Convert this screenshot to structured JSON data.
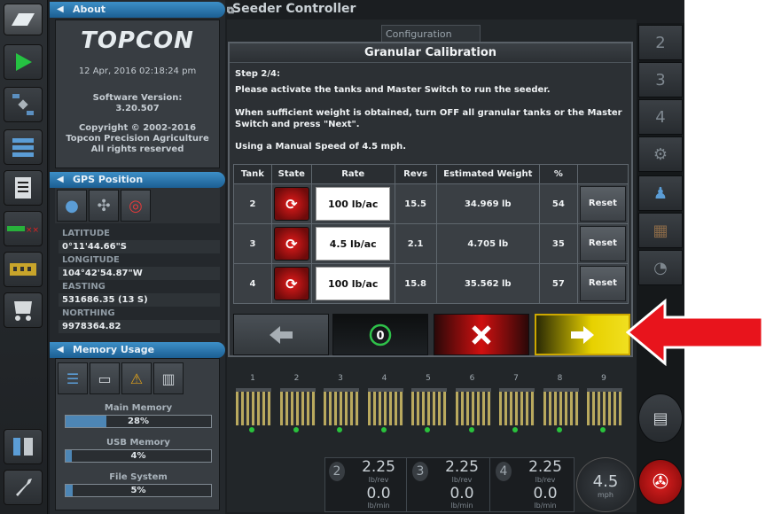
{
  "app": {
    "title": "Seeder Controller",
    "tab_behind": "Configuration"
  },
  "about": {
    "header": "About",
    "logo": "TOPCON",
    "datetime": "12 Apr, 2016  02:18:24 pm",
    "version_label": "Software Version:",
    "version": "3.20.507",
    "copyright": [
      "Copyright © 2002-2016",
      "Topcon Precision Agriculture",
      "All rights reserved"
    ]
  },
  "gps": {
    "header": "GPS Position",
    "rows": [
      {
        "label": "LATITUDE",
        "value": "0°11'44.66\"S"
      },
      {
        "label": "LONGITUDE",
        "value": "104°42'54.87\"W"
      },
      {
        "label": "EASTING",
        "value": "531686.35 (13 S)"
      },
      {
        "label": "NORTHING",
        "value": "9978364.82"
      }
    ]
  },
  "memory": {
    "header": "Memory Usage",
    "items": [
      {
        "label": "Main Memory",
        "percent": 28,
        "text": "28%"
      },
      {
        "label": "USB Memory",
        "percent": 4,
        "text": "4%"
      },
      {
        "label": "File System",
        "percent": 5,
        "text": "5%"
      }
    ]
  },
  "dialog": {
    "title": "Granular Calibration",
    "step": "Step 2/4:",
    "line1": "Please activate the tanks and Master Switch to run the seeder.",
    "line2": "When sufficient weight is obtained, turn OFF all granular tanks or the Master Switch and press \"Next\".",
    "line3": "Using a Manual Speed of 4.5 mph.",
    "columns": [
      "Tank",
      "State",
      "Rate",
      "Revs",
      "Estimated Weight",
      "%",
      ""
    ],
    "rows": [
      {
        "tank": "2",
        "rate": "100 lb/ac",
        "revs": "15.5",
        "weight": "34.969 lb",
        "pct": "54",
        "reset": "Reset"
      },
      {
        "tank": "3",
        "rate": "4.5 lb/ac",
        "revs": "2.1",
        "weight": "4.705 lb",
        "pct": "35",
        "reset": "Reset"
      },
      {
        "tank": "4",
        "rate": "100 lb/ac",
        "revs": "15.8",
        "weight": "35.562 lb",
        "pct": "57",
        "reset": "Reset"
      }
    ]
  },
  "right_rail": [
    "2",
    "3",
    "4"
  ],
  "sections": [
    "1",
    "2",
    "3",
    "4",
    "5",
    "6",
    "7",
    "8",
    "9"
  ],
  "readouts": [
    {
      "tank": "2",
      "rev": "2.25",
      "rev_unit": "lb/rev",
      "rate": "0.0",
      "rate_unit": "lb/min"
    },
    {
      "tank": "3",
      "rev": "2.25",
      "rev_unit": "lb/rev",
      "rate": "0.0",
      "rate_unit": "lb/min"
    },
    {
      "tank": "4",
      "rev": "2.25",
      "rev_unit": "lb/rev",
      "rate": "0.0",
      "rate_unit": "lb/min"
    }
  ],
  "speed": {
    "value": "4.5",
    "unit": "mph"
  },
  "colors": {
    "accent_blue": "#2a7ab8",
    "cancel_red": "#d01010",
    "next_yellow": "#e7d100",
    "arrow_red": "#e8141c"
  }
}
